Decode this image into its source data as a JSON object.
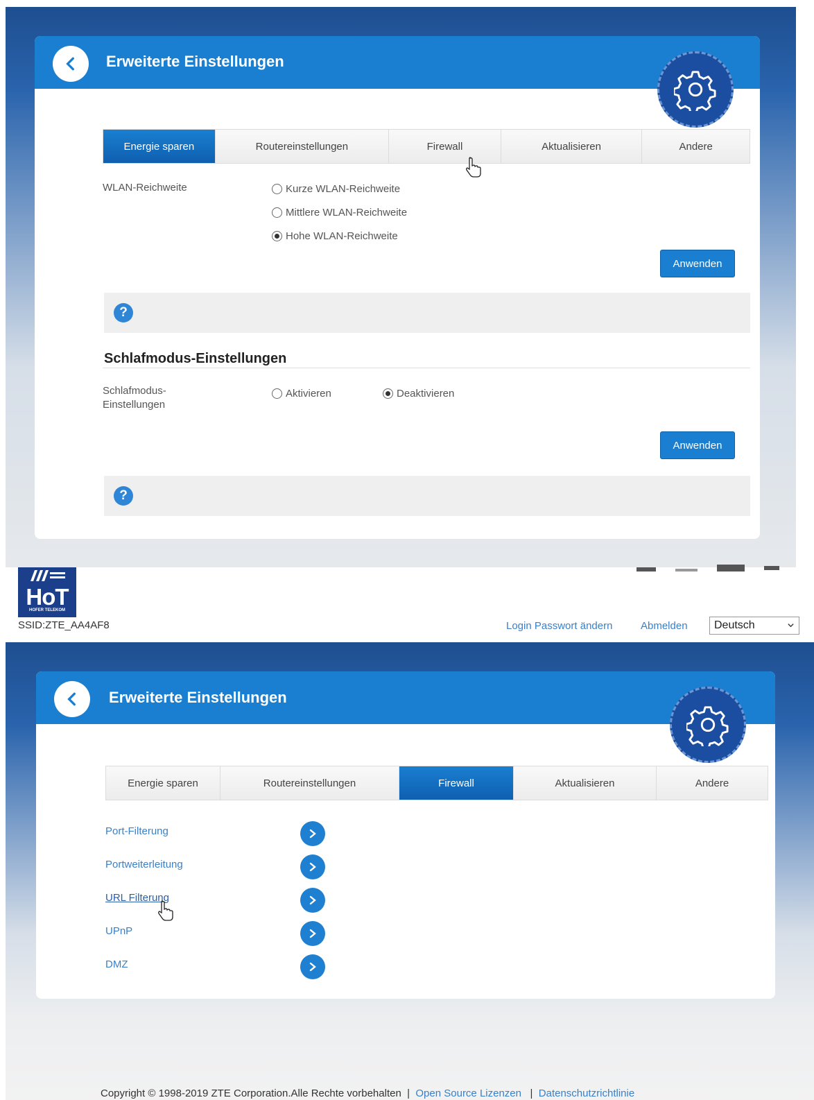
{
  "top": {
    "title": "Erweiterte Einstellungen",
    "tabs": [
      {
        "label": "Energie sparen",
        "active": true
      },
      {
        "label": "Routereinstellungen",
        "active": false
      },
      {
        "label": "Firewall",
        "active": false
      },
      {
        "label": "Aktualisieren",
        "active": false
      },
      {
        "label": "Andere",
        "active": false
      }
    ],
    "wlan": {
      "label": "WLAN-Reichweite",
      "options": [
        {
          "label": "Kurze WLAN-Reichweite",
          "checked": false
        },
        {
          "label": "Mittlere WLAN-Reichweite",
          "checked": false
        },
        {
          "label": "Hohe WLAN-Reichweite",
          "checked": true
        }
      ],
      "apply_label": "Anwenden"
    },
    "help_glyph": "?",
    "sleep": {
      "section_title": "Schlafmodus-Einstellungen",
      "label_line1": "Schlafmodus-",
      "label_line2": "Einstellungen",
      "options": [
        {
          "label": "Aktivieren",
          "checked": false
        },
        {
          "label": "Deaktivieren",
          "checked": true
        }
      ],
      "apply_label": "Anwenden"
    }
  },
  "bottom": {
    "logo_text": "HoT",
    "logo_sub": "HOFER TELEKOM",
    "ssid": "SSID:ZTE_AA4AF8",
    "links": {
      "change_password": "Login Passwort ändern",
      "logout": "Abmelden"
    },
    "language": "Deutsch",
    "title": "Erweiterte Einstellungen",
    "tabs": [
      {
        "label": "Energie sparen",
        "active": false
      },
      {
        "label": "Routereinstellungen",
        "active": false
      },
      {
        "label": "Firewall",
        "active": true
      },
      {
        "label": "Aktualisieren",
        "active": false
      },
      {
        "label": "Andere",
        "active": false
      }
    ],
    "firewall_items": [
      {
        "label": "Port-Filterung"
      },
      {
        "label": "Portweiterleitung"
      },
      {
        "label": "URL Filterung"
      },
      {
        "label": "UPnP"
      },
      {
        "label": "DMZ"
      }
    ],
    "footer": {
      "copyright": "Copyright © 1998-2019 ZTE Corporation.Alle Rechte vorbehalten",
      "sep1": "|",
      "open_source": "Open Source Lizenzen",
      "sep2": "|",
      "privacy": "Datenschutzrichtlinie"
    }
  },
  "colors": {
    "accent": "#1a7fd0",
    "header_dark": "#1e4e90",
    "link": "#3a80c8"
  }
}
